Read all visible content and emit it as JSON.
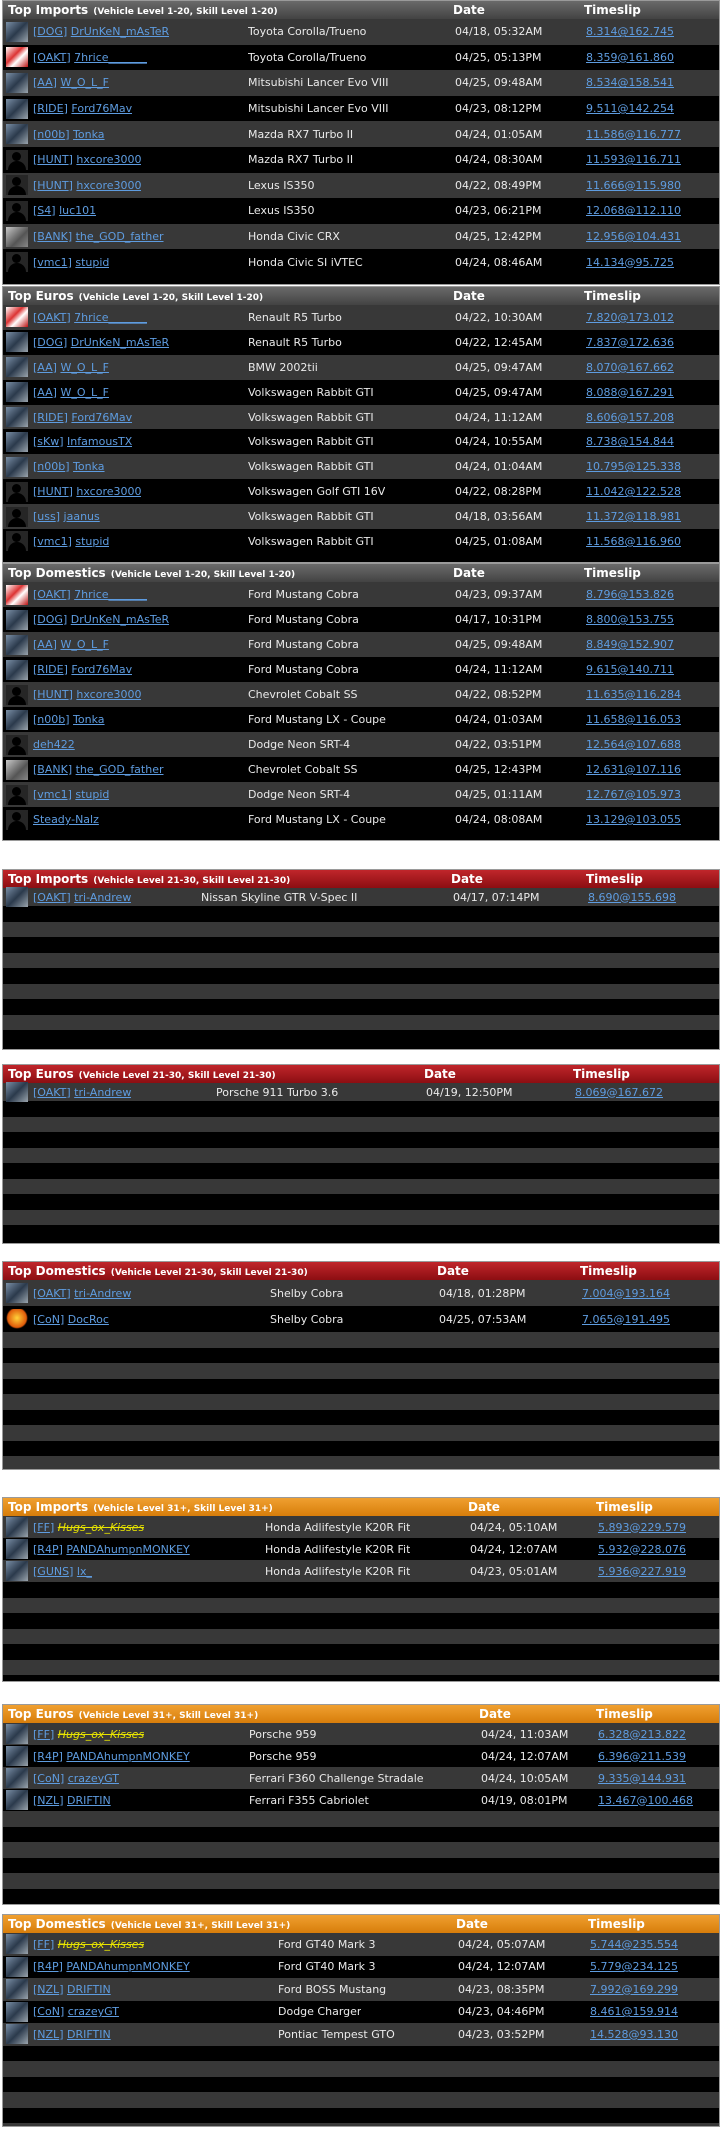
{
  "groups": [
    {
      "theme": "grey",
      "title": "Top Imports",
      "sub": "(Vehicle Level 1-20, Skill Level 1-20)",
      "date_label": "Date",
      "time_label": "Timeslip",
      "rows": [
        {
          "av": "pic",
          "tag": "DOG",
          "name": "DrUnKeN_mAsTeR",
          "car": "Toyota Corolla/Trueno",
          "date": "04/18, 05:32AM",
          "time": "8.314@162.745"
        },
        {
          "av": "red",
          "tag": "OAKT",
          "name": "7hrice_______",
          "car": "Toyota Corolla/Trueno",
          "date": "04/25, 05:13PM",
          "time": "8.359@161.860"
        },
        {
          "av": "pic",
          "tag": "AA",
          "name": "W_O_L_F",
          "car": "Mitsubishi Lancer Evo VIII",
          "date": "04/25, 09:48AM",
          "time": "8.534@158.541"
        },
        {
          "av": "pic",
          "tag": "RIDE",
          "name": "Ford76Mav",
          "car": "Mitsubishi Lancer Evo VIII",
          "date": "04/23, 08:12PM",
          "time": "9.511@142.254"
        },
        {
          "av": "pic",
          "tag": "n00b",
          "name": "Tonka",
          "car": "Mazda RX7 Turbo II",
          "date": "04/24, 01:05AM",
          "time": "11.586@116.777"
        },
        {
          "av": "gen",
          "tag": "HUNT",
          "name": "hxcore3000",
          "car": "Mazda RX7 Turbo II",
          "date": "04/24, 08:30AM",
          "time": "11.593@116.711"
        },
        {
          "av": "gen",
          "tag": "HUNT",
          "name": "hxcore3000",
          "car": "Lexus IS350",
          "date": "04/22, 08:49PM",
          "time": "11.666@115.980"
        },
        {
          "av": "gen",
          "tag": "S4",
          "name": "luc101",
          "car": "Lexus IS350",
          "date": "04/23, 06:21PM",
          "time": "12.068@112.110"
        },
        {
          "av": "dino",
          "tag": "BANK",
          "name": "the_GOD_father",
          "car": "Honda Civic CRX",
          "date": "04/25, 12:42PM",
          "time": "12.956@104.431"
        },
        {
          "av": "gen",
          "tag": "vmc1",
          "name": "stupid",
          "car": "Honda Civic SI iVTEC",
          "date": "04/24, 08:46AM",
          "time": "14.134@95.725"
        }
      ]
    },
    {
      "theme": "grey",
      "title": "Top Euros",
      "sub": "(Vehicle Level 1-20, Skill Level 1-20)",
      "date_label": "Date",
      "time_label": "Timeslip",
      "rows": [
        {
          "av": "red",
          "tag": "OAKT",
          "name": "7hrice_______",
          "car": "Renault R5 Turbo",
          "date": "04/22, 10:30AM",
          "time": "7.820@173.012"
        },
        {
          "av": "pic",
          "tag": "DOG",
          "name": "DrUnKeN_mAsTeR",
          "car": "Renault R5 Turbo",
          "date": "04/22, 12:45AM",
          "time": "7.837@172.636"
        },
        {
          "av": "pic",
          "tag": "AA",
          "name": "W_O_L_F",
          "car": "BMW 2002tii",
          "date": "04/25, 09:47AM",
          "time": "8.070@167.662"
        },
        {
          "av": "pic",
          "tag": "AA",
          "name": "W_O_L_F",
          "car": "Volkswagen Rabbit GTI",
          "date": "04/25, 09:47AM",
          "time": "8.088@167.291"
        },
        {
          "av": "pic",
          "tag": "RIDE",
          "name": "Ford76Mav",
          "car": "Volkswagen Rabbit GTI",
          "date": "04/24, 11:12AM",
          "time": "8.606@157.208"
        },
        {
          "av": "pic",
          "tag": "sKw",
          "name": "InfamousTX",
          "car": "Volkswagen Rabbit GTI",
          "date": "04/24, 10:55AM",
          "time": "8.738@154.844"
        },
        {
          "av": "pic",
          "tag": "n00b",
          "name": "Tonka",
          "car": "Volkswagen Rabbit GTI",
          "date": "04/24, 01:04AM",
          "time": "10.795@125.338"
        },
        {
          "av": "gen",
          "tag": "HUNT",
          "name": "hxcore3000",
          "car": "Volkswagen Golf GTI 16V",
          "date": "04/22, 08:28PM",
          "time": "11.042@122.528"
        },
        {
          "av": "gen",
          "tag": "uss",
          "name": "jaanus",
          "car": "Volkswagen Rabbit GTI",
          "date": "04/18, 03:56AM",
          "time": "11.372@118.981"
        },
        {
          "av": "gen",
          "tag": "vmc1",
          "name": "stupid",
          "car": "Volkswagen Rabbit GTI",
          "date": "04/25, 01:08AM",
          "time": "11.568@116.960"
        }
      ]
    },
    {
      "theme": "grey",
      "title": "Top Domestics",
      "sub": "(Vehicle Level 1-20, Skill Level 1-20)",
      "date_label": "Date",
      "time_label": "Timeslip",
      "rows": [
        {
          "av": "red",
          "tag": "OAKT",
          "name": "7hrice_______",
          "car": "Ford Mustang Cobra",
          "date": "04/23, 09:37AM",
          "time": "8.796@153.826"
        },
        {
          "av": "pic",
          "tag": "DOG",
          "name": "DrUnKeN_mAsTeR",
          "car": "Ford Mustang Cobra",
          "date": "04/17, 10:31PM",
          "time": "8.800@153.755"
        },
        {
          "av": "pic",
          "tag": "AA",
          "name": "W_O_L_F",
          "car": "Ford Mustang Cobra",
          "date": "04/25, 09:48AM",
          "time": "8.849@152.907"
        },
        {
          "av": "pic",
          "tag": "RIDE",
          "name": "Ford76Mav",
          "car": "Ford Mustang Cobra",
          "date": "04/24, 11:12AM",
          "time": "9.615@140.711"
        },
        {
          "av": "gen",
          "tag": "HUNT",
          "name": "hxcore3000",
          "car": "Chevrolet Cobalt SS",
          "date": "04/22, 08:52PM",
          "time": "11.635@116.284"
        },
        {
          "av": "pic",
          "tag": "n00b",
          "name": "Tonka",
          "car": "Ford Mustang LX - Coupe",
          "date": "04/24, 01:03AM",
          "time": "11.658@116.053"
        },
        {
          "av": "gen",
          "tag": "",
          "name": "deh422",
          "car": "Dodge Neon SRT-4",
          "date": "04/22, 03:51PM",
          "time": "12.564@107.688"
        },
        {
          "av": "dino",
          "tag": "BANK",
          "name": "the_GOD_father",
          "car": "Chevrolet Cobalt SS",
          "date": "04/25, 12:43PM",
          "time": "12.631@107.116"
        },
        {
          "av": "gen",
          "tag": "vmc1",
          "name": "stupid",
          "car": "Dodge Neon SRT-4",
          "date": "04/25, 01:11AM",
          "time": "12.767@105.973"
        },
        {
          "av": "gen",
          "tag": "",
          "name": "Steady-Nalz",
          "car": "Ford Mustang LX - Coupe",
          "date": "04/24, 08:08AM",
          "time": "13.129@103.055"
        }
      ]
    },
    {
      "theme": "red",
      "title": "Top Imports",
      "sub": "(Vehicle Level 21-30, Skill Level 21-30)",
      "date_label": "Date",
      "time_label": "Timeslip",
      "rows": [
        {
          "av": "pic",
          "tag": "OAKT",
          "name": "tri-Andrew",
          "car": "Nissan Skyline GTR V-Spec II",
          "date": "04/17, 07:14PM",
          "time": "8.690@155.698"
        }
      ]
    },
    {
      "theme": "red",
      "title": "Top Euros",
      "sub": "(Vehicle Level 21-30, Skill Level 21-30)",
      "date_label": "Date",
      "time_label": "Timeslip",
      "rows": [
        {
          "av": "pic",
          "tag": "OAKT",
          "name": "tri-Andrew",
          "car": "Porsche 911 Turbo 3.6",
          "date": "04/19, 12:50PM",
          "time": "8.069@167.672"
        }
      ]
    },
    {
      "theme": "red",
      "title": "Top Domestics",
      "sub": "(Vehicle Level 21-30, Skill Level 21-30)",
      "date_label": "Date",
      "time_label": "Timeslip",
      "rows": [
        {
          "av": "pic",
          "tag": "OAKT",
          "name": "tri-Andrew",
          "car": "Shelby Cobra",
          "date": "04/18, 01:28PM",
          "time": "7.004@193.164"
        },
        {
          "av": "orange",
          "tag": "CoN",
          "name": "DocRoc",
          "car": "Shelby Cobra",
          "date": "04/25, 07:53AM",
          "time": "7.065@191.495"
        }
      ]
    },
    {
      "theme": "orange",
      "title": "Top Imports",
      "sub": "(Vehicle Level 31+, Skill Level 31+)",
      "date_label": "Date",
      "time_label": "Timeslip",
      "rows": [
        {
          "av": "pic",
          "tag": "FF",
          "name": "Hugs_ox_Kisses",
          "hl": true,
          "car": "Honda Adlifestyle K20R Fit",
          "date": "04/24, 05:10AM",
          "time": "5.893@229.579"
        },
        {
          "av": "pic",
          "tag": "R4P",
          "name": "PANDAhumpnMONKEY",
          "car": "Honda Adlifestyle K20R Fit",
          "date": "04/24, 12:07AM",
          "time": "5.932@228.076"
        },
        {
          "av": "pic",
          "tag": "GUNS",
          "name": "lx_",
          "car": "Honda Adlifestyle K20R Fit",
          "date": "04/23, 05:01AM",
          "time": "5.936@227.919"
        }
      ]
    },
    {
      "theme": "orange",
      "title": "Top Euros",
      "sub": "(Vehicle Level 31+, Skill Level 31+)",
      "date_label": "Date",
      "time_label": "Timeslip",
      "rows": [
        {
          "av": "pic",
          "tag": "FF",
          "name": "Hugs_ox_Kisses",
          "hl": true,
          "car": "Porsche 959",
          "date": "04/24, 11:03AM",
          "time": "6.328@213.822"
        },
        {
          "av": "pic",
          "tag": "R4P",
          "name": "PANDAhumpnMONKEY",
          "car": "Porsche 959",
          "date": "04/24, 12:07AM",
          "time": "6.396@211.539"
        },
        {
          "av": "pic",
          "tag": "CoN",
          "name": "crazeyGT",
          "car": "Ferrari F360 Challenge Stradale",
          "date": "04/24, 10:05AM",
          "time": "9.335@144.931"
        },
        {
          "av": "pic",
          "tag": "NZL",
          "name": "DRIFTIN",
          "car": "Ferrari F355 Cabriolet",
          "date": "04/19, 08:01PM",
          "time": "13.467@100.468"
        }
      ]
    },
    {
      "theme": "orange",
      "title": "Top Domestics",
      "sub": "(Vehicle Level 31+, Skill Level 31+)",
      "date_label": "Date",
      "time_label": "Timeslip",
      "rows": [
        {
          "av": "pic",
          "tag": "FF",
          "name": "Hugs_ox_Kisses",
          "hl": true,
          "car": "Ford GT40 Mark 3",
          "date": "04/24, 05:07AM",
          "time": "5.744@235.554"
        },
        {
          "av": "pic",
          "tag": "R4P",
          "name": "PANDAhumpnMONKEY",
          "car": "Ford GT40 Mark 3",
          "date": "04/24, 12:07AM",
          "time": "5.779@234.125"
        },
        {
          "av": "pic",
          "tag": "NZL",
          "name": "DRIFTIN",
          "car": "Ford BOSS Mustang",
          "date": "04/23, 08:35PM",
          "time": "7.992@169.299"
        },
        {
          "av": "pic",
          "tag": "CoN",
          "name": "crazeyGT",
          "car": "Dodge Charger",
          "date": "04/23, 04:46PM",
          "time": "8.461@159.914"
        },
        {
          "av": "pic",
          "tag": "NZL",
          "name": "DRIFTIN",
          "car": "Pontiac Tempest GTO",
          "date": "04/23, 03:52PM",
          "time": "14.528@93.130"
        }
      ]
    }
  ]
}
